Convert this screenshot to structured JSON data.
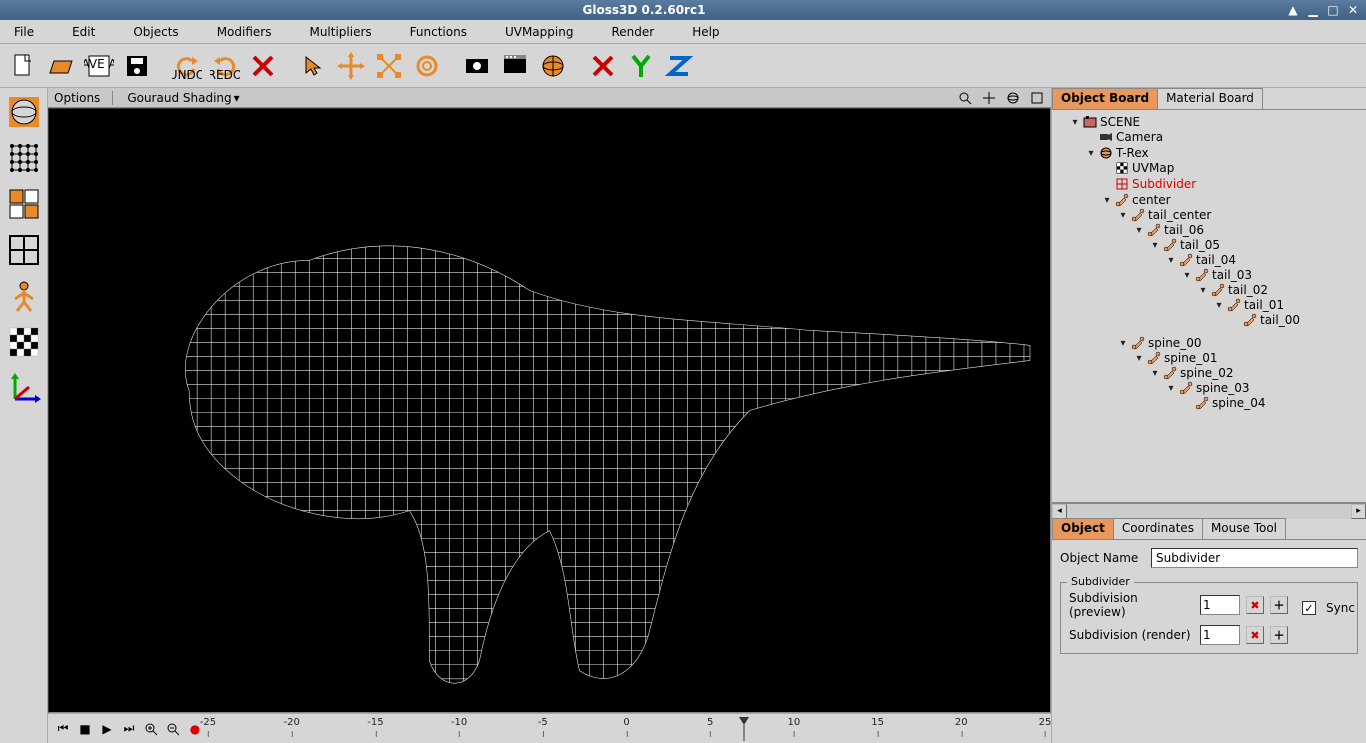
{
  "window": {
    "title": "Gloss3D 0.2.60rc1"
  },
  "menu": [
    "File",
    "Edit",
    "Objects",
    "Modifiers",
    "Multipliers",
    "Functions",
    "UVMapping",
    "Render",
    "Help"
  ],
  "toolbar": [
    {
      "name": "new-file",
      "tip": "New"
    },
    {
      "name": "open-file",
      "tip": "Open"
    },
    {
      "name": "save-as",
      "tip": "Save As"
    },
    {
      "name": "save",
      "tip": "Save"
    },
    {
      "name": "sep"
    },
    {
      "name": "undo",
      "tip": "Undo"
    },
    {
      "name": "redo",
      "tip": "Redo"
    },
    {
      "name": "delete",
      "tip": "Delete"
    },
    {
      "name": "sep"
    },
    {
      "name": "pick",
      "tip": "Pick"
    },
    {
      "name": "move",
      "tip": "Move"
    },
    {
      "name": "scale",
      "tip": "Scale"
    },
    {
      "name": "rotate",
      "tip": "Rotate"
    },
    {
      "name": "sep"
    },
    {
      "name": "render-view",
      "tip": "Render View"
    },
    {
      "name": "render-final",
      "tip": "Render"
    },
    {
      "name": "make-editable",
      "tip": "Make Editable"
    },
    {
      "name": "sep"
    },
    {
      "name": "x-axis",
      "tip": "X"
    },
    {
      "name": "y-axis",
      "tip": "Y"
    },
    {
      "name": "z-axis",
      "tip": "Z"
    }
  ],
  "left_tools": [
    {
      "name": "object-mode"
    },
    {
      "name": "vertex-mode"
    },
    {
      "name": "edge-mode"
    },
    {
      "name": "face-mode"
    },
    {
      "name": "skin-mode"
    },
    {
      "name": "uvw-mode"
    },
    {
      "name": "axis-mode"
    }
  ],
  "viewport": {
    "options_label": "Options",
    "shading": "Gouraud Shading",
    "nav_icons": [
      "zoom-icon",
      "pan-icon",
      "orbit-icon",
      "maximize-icon"
    ]
  },
  "timeline": {
    "controls": [
      "first-frame",
      "stop",
      "play",
      "last-frame",
      "zoom-in",
      "zoom-out",
      "record"
    ],
    "ticks": [
      -25,
      -20,
      -15,
      -10,
      -5,
      0,
      5,
      10,
      15,
      20,
      25
    ],
    "playhead": 7
  },
  "right_tabs": [
    "Object Board",
    "Material Board"
  ],
  "scene_tree": {
    "name": "SCENE",
    "icon": "scene-icon",
    "children": [
      {
        "name": "Camera",
        "icon": "camera-icon"
      },
      {
        "name": "T-Rex",
        "icon": "mesh-icon",
        "children": [
          {
            "name": "UVMap",
            "icon": "uvmap-icon"
          },
          {
            "name": "Subdivider",
            "icon": "subdivider-icon",
            "selected": true
          },
          {
            "name": "center",
            "icon": "bone-icon",
            "children": [
              {
                "name": "tail_center",
                "icon": "bone-icon",
                "children": [
                  {
                    "name": "tail_06",
                    "icon": "bone-icon",
                    "children": [
                      {
                        "name": "tail_05",
                        "icon": "bone-icon",
                        "children": [
                          {
                            "name": "tail_04",
                            "icon": "bone-icon",
                            "children": [
                              {
                                "name": "tail_03",
                                "icon": "bone-icon",
                                "children": [
                                  {
                                    "name": "tail_02",
                                    "icon": "bone-icon",
                                    "children": [
                                      {
                                        "name": "tail_01",
                                        "icon": "bone-icon",
                                        "children": [
                                          {
                                            "name": "tail_00",
                                            "icon": "bone-icon"
                                          }
                                        ]
                                      }
                                    ]
                                  }
                                ]
                              }
                            ]
                          }
                        ]
                      }
                    ]
                  }
                ]
              },
              {
                "name": "spine_00",
                "icon": "bone-icon",
                "children": [
                  {
                    "name": "spine_01",
                    "icon": "bone-icon",
                    "children": [
                      {
                        "name": "spine_02",
                        "icon": "bone-icon",
                        "children": [
                          {
                            "name": "spine_03",
                            "icon": "bone-icon",
                            "children": [
                              {
                                "name": "spine_04",
                                "icon": "bone-icon"
                              }
                            ]
                          }
                        ]
                      }
                    ]
                  }
                ]
              }
            ]
          }
        ]
      }
    ]
  },
  "prop_tabs": [
    "Object",
    "Coordinates",
    "Mouse Tool"
  ],
  "prop": {
    "name_label": "Object Name",
    "name_value": "Subdivider",
    "group_label": "Subdivider",
    "sub_preview_label": "Subdivision (preview)",
    "sub_preview_value": "1",
    "sub_render_label": "Subdivision (render)",
    "sub_render_value": "1",
    "sync_label": "Sync",
    "sync_checked": true
  }
}
